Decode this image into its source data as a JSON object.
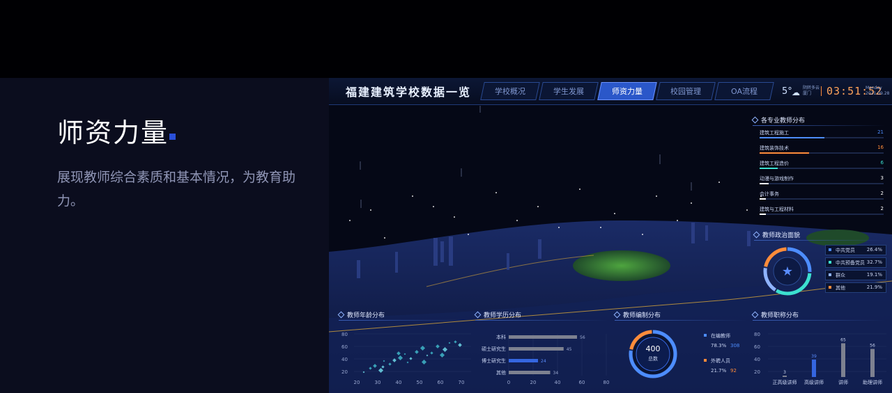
{
  "hero": {
    "title": "师资力量",
    "description": "展现教师综合素质和基本情况，为教育助力。"
  },
  "header": {
    "app_title": "福建建筑学校数据一览",
    "tabs": [
      "学校概况",
      "学生发展",
      "师资力量",
      "校园管理",
      "OA流程"
    ],
    "active_tab": "师资力量",
    "temperature": "5°",
    "weather_icon": "cloud-icon",
    "location": "阴转多云",
    "city": "厦门",
    "time": "03:51:52",
    "weekday": "Monday",
    "date": "2021.09.28"
  },
  "majors": {
    "title": "各专业教师分布",
    "items": [
      {
        "label": "建筑工程施工",
        "value": "21",
        "color": "#4d8dff"
      },
      {
        "label": "建筑装饰技术",
        "value": "16",
        "color": "#ff8c3a"
      },
      {
        "label": "建筑工程造价",
        "value": "6",
        "color": "#3ce0d0"
      },
      {
        "label": "动漫与游戏制作",
        "value": "3",
        "color": "#ffffff"
      },
      {
        "label": "会计事务",
        "value": "2",
        "color": "#ffffff"
      },
      {
        "label": "建筑与工程材料",
        "value": "2",
        "color": "#ffffff"
      }
    ]
  },
  "politics": {
    "title": "教师政治面貌",
    "items": [
      {
        "label": "中共党员",
        "value": "26.4%",
        "color": "#4d8dff"
      },
      {
        "label": "中共预备党员",
        "value": "32.7%",
        "color": "#3ce0d0"
      },
      {
        "label": "群众",
        "value": "19.1%",
        "color": "#8fb3ff"
      },
      {
        "label": "其他",
        "value": "21.9%",
        "color": "#ff8c3a"
      }
    ]
  },
  "age": {
    "title": "教师年龄分布",
    "y_ticks": [
      "80",
      "60",
      "40",
      "20"
    ],
    "x_ticks": [
      "20",
      "30",
      "40",
      "50",
      "60",
      "70"
    ]
  },
  "education": {
    "title": "教师学历分布",
    "items": [
      {
        "label": "本科",
        "value": "56"
      },
      {
        "label": "硕士研究生",
        "value": "45"
      },
      {
        "label": "博士研究生",
        "value": "24"
      },
      {
        "label": "其他",
        "value": "34"
      }
    ],
    "x_ticks": [
      "0",
      "20",
      "40",
      "60",
      "80"
    ]
  },
  "staffing": {
    "title": "教师编制分布",
    "total": "400",
    "total_label": "总数",
    "items": [
      {
        "label": "在编教师",
        "percent": "78.3%",
        "count": "308",
        "color": "#4d8dff"
      },
      {
        "label": "外聘人员",
        "percent": "21.7%",
        "count": "92",
        "color": "#ff8c3a"
      }
    ]
  },
  "titles": {
    "title": "教师职称分布",
    "y_ticks": [
      "80",
      "60",
      "40",
      "20"
    ],
    "items": [
      {
        "label": "正高级讲师",
        "value": "3"
      },
      {
        "label": "高级讲师",
        "value": "39"
      },
      {
        "label": "讲师",
        "value": "65"
      },
      {
        "label": "助理讲师",
        "value": "56"
      }
    ]
  }
}
